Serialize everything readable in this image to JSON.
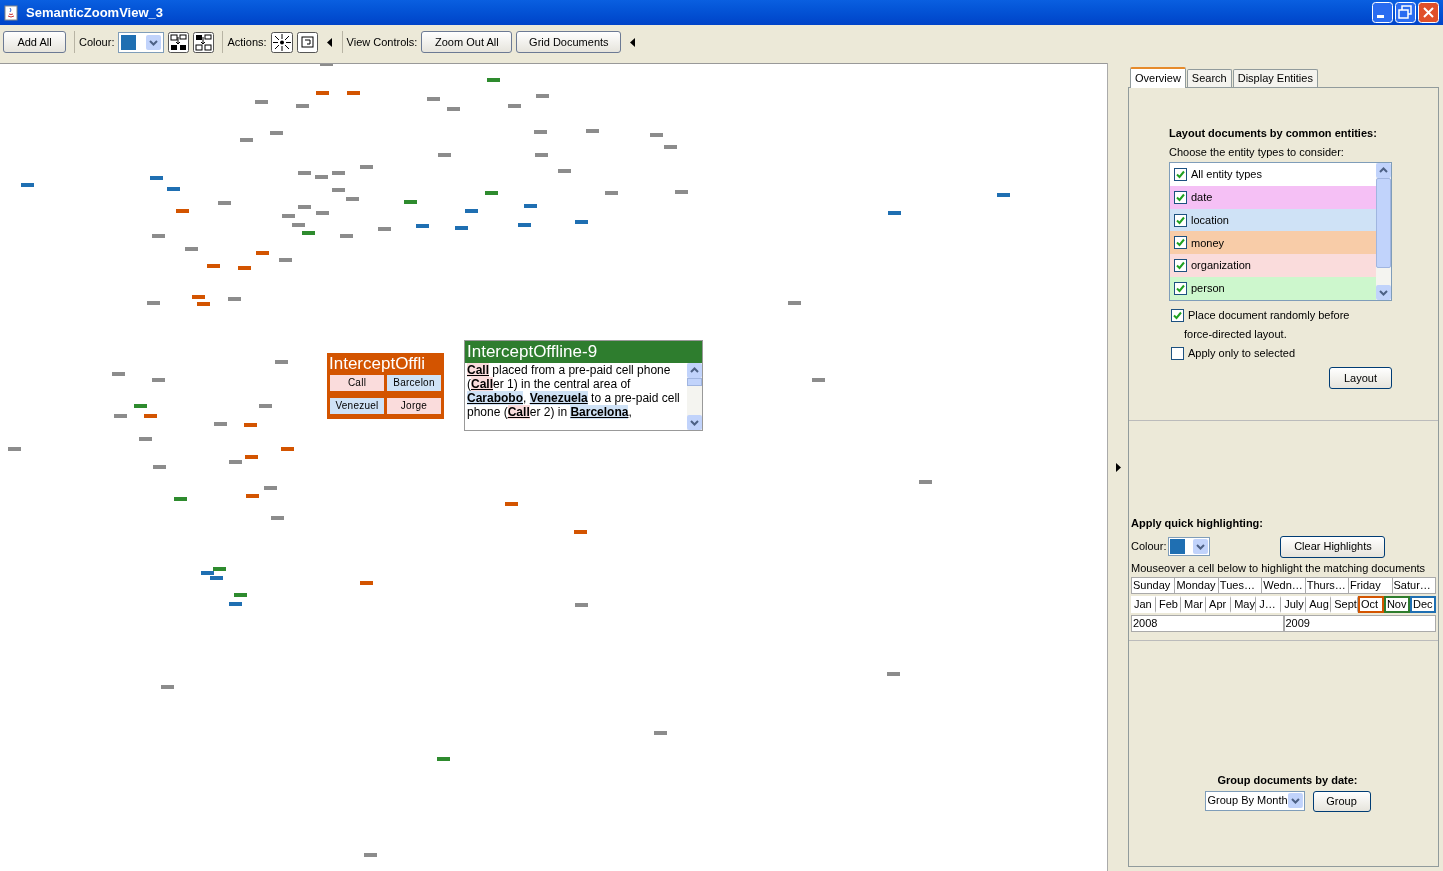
{
  "window": {
    "title": "SemanticZoomView_3"
  },
  "toolbar": {
    "add_all": "Add All",
    "colour_label": "Colour:",
    "actions_label": "Actions:",
    "view_controls_label": "View Controls:",
    "zoom_out_all": "Zoom Out All",
    "grid_documents": "Grid Documents",
    "colour_swatch": {
      "color": "#1f6fb2"
    }
  },
  "cards": [
    {
      "kind": "grid",
      "title": "InterceptOffli",
      "color": "#d35400",
      "cells": [
        {
          "text": "Call",
          "color": "#fadcdc"
        },
        {
          "text": "Barcelon",
          "color": "#cfe2f6"
        },
        {
          "text": "Venezuel",
          "color": "#cfe2f6"
        },
        {
          "text": "Jorge",
          "color": "#fadcdc"
        }
      ]
    },
    {
      "kind": "text",
      "title": "InterceptOffline-9",
      "color": "#2e7d2e",
      "segments": [
        {
          "text": "Call",
          "color": "#fadcdc"
        },
        {
          "text": " placed from a pre-paid cell phone ("
        },
        {
          "text": "Call",
          "color": "#fadcdc"
        },
        {
          "text": "er 1) in the central area of "
        },
        {
          "text": "Carabobo",
          "color": "#cfe2f6"
        },
        {
          "text": ", "
        },
        {
          "text": "Venezuela",
          "color": "#cfe2f6"
        },
        {
          "text": " to a pre-paid cell phone ("
        },
        {
          "text": "Call",
          "color": "#fadcdc"
        },
        {
          "text": "er 2) in "
        },
        {
          "text": "Barcelona",
          "color": "#cfe2f6"
        },
        {
          "text": ","
        }
      ]
    }
  ],
  "tabs": [
    {
      "label": "Overview",
      "selected": true
    },
    {
      "label": "Search",
      "selected": false
    },
    {
      "label": "Display Entities",
      "selected": false
    }
  ],
  "layout_section": {
    "heading": "Layout documents by common entities:",
    "subheading": "Choose the entity types to consider:",
    "entity_types": [
      {
        "label": "All entity types",
        "checked": true,
        "color": "#ffffff"
      },
      {
        "label": "date",
        "checked": true,
        "color": "#f5c0f5"
      },
      {
        "label": "location",
        "checked": true,
        "color": "#cfe2f6"
      },
      {
        "label": "money",
        "checked": true,
        "color": "#f8cca8"
      },
      {
        "label": "organization",
        "checked": true,
        "color": "#fadcdc"
      },
      {
        "label": "person",
        "checked": true,
        "color": "#cdf7cd"
      }
    ],
    "options": [
      {
        "label": "Place document randomly before",
        "label2": "force-directed layout.",
        "checked": true
      },
      {
        "label": "Apply only to selected",
        "checked": false
      }
    ],
    "button": "Layout"
  },
  "highlight_section": {
    "heading": "Apply quick highlighting:",
    "colour_label": "Colour:",
    "colour_swatch": {
      "color": "#1f6fb2"
    },
    "button": "Clear Highlights",
    "hint": "Mouseover a cell below to highlight the matching documents",
    "days": [
      "Sunday",
      "Monday",
      "Tues…",
      "Wedn…",
      "Thurs…",
      "Friday",
      "Satur…"
    ],
    "months": [
      {
        "label": "Jan"
      },
      {
        "label": "Feb"
      },
      {
        "label": "Mar"
      },
      {
        "label": "Apr"
      },
      {
        "label": "May"
      },
      {
        "label": "J…"
      },
      {
        "label": "July"
      },
      {
        "label": "Aug"
      },
      {
        "label": "Sept"
      },
      {
        "label": "Oct",
        "color": "#d35400"
      },
      {
        "label": "Nov",
        "color": "#2e7d2e"
      },
      {
        "label": "Dec",
        "color": "#1f6fb2"
      }
    ],
    "years": [
      "2008",
      "2009"
    ]
  },
  "group_section": {
    "heading": "Group documents by date:",
    "select": "Group By Month",
    "button": "Group"
  }
}
